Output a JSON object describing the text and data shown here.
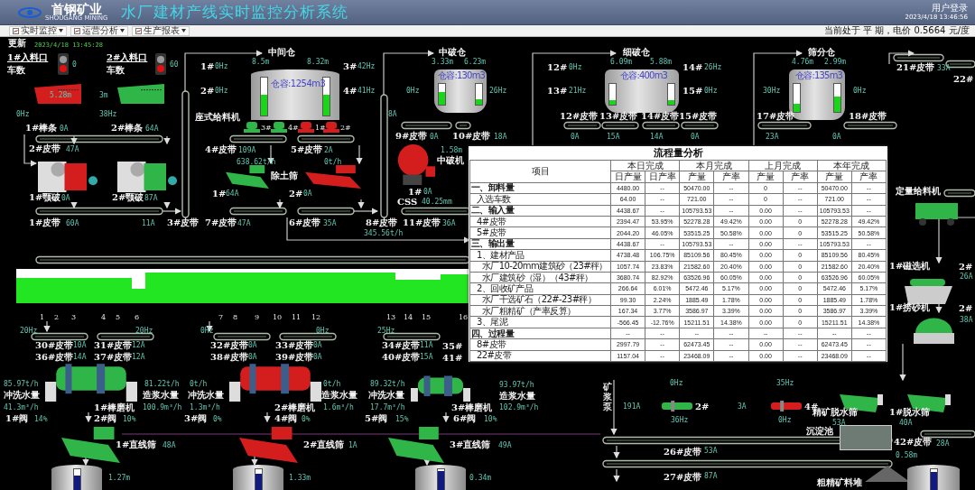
{
  "header": {
    "logo_text": "首钢矿业",
    "logo_subtext": "SHOUGANG MINING",
    "title": "水厂建材产线实时监控分析系统",
    "user_link": "用户登录",
    "time": "2023/4/18 13:46:56"
  },
  "toolbar": {
    "menus": [
      "实时监控",
      "运营分析",
      "生产报表"
    ],
    "price_info": "当前处于 平 期，电价 0.5664 元/度"
  },
  "labels": [
    {
      "text": "更新",
      "kind": "name"
    },
    {
      "text": "2023/4/18 13:45:28",
      "kind": "small"
    },
    {
      "text": "1#入料口",
      "kind": "link"
    },
    {
      "text": "0",
      "kind": "value"
    },
    {
      "text": "车数",
      "kind": "name"
    },
    {
      "text": "2#入料口",
      "kind": "link"
    },
    {
      "text": "车数",
      "kind": "name"
    },
    {
      "text": "60",
      "kind": "value"
    },
    {
      "text": "5.28m",
      "kind": "value"
    },
    {
      "text": "3m",
      "kind": "value"
    },
    {
      "text": "0Hz",
      "kind": "value"
    },
    {
      "text": "38Hz",
      "kind": "value"
    },
    {
      "text": "1#棒条",
      "kind": "name"
    },
    {
      "text": "0A",
      "kind": "value"
    },
    {
      "text": "2#棒条",
      "kind": "name"
    },
    {
      "text": "64A",
      "kind": "value"
    },
    {
      "text": "2#皮带",
      "kind": "name"
    },
    {
      "text": "47A",
      "kind": "value"
    },
    {
      "text": "1#颚破",
      "kind": "name"
    },
    {
      "text": "0A",
      "kind": "value"
    },
    {
      "text": "2#颚破",
      "kind": "name"
    },
    {
      "text": "87A",
      "kind": "value"
    },
    {
      "text": "1#皮带",
      "kind": "name"
    },
    {
      "text": "60A",
      "kind": "value"
    },
    {
      "text": "11A",
      "kind": "value"
    },
    {
      "text": "3#皮带",
      "kind": "name"
    },
    {
      "text": "中间仓",
      "kind": "name"
    },
    {
      "text": "1#",
      "kind": "name"
    },
    {
      "text": "0Hz",
      "kind": "value"
    },
    {
      "text": "8.5m",
      "kind": "value"
    },
    {
      "text": "8.32m",
      "kind": "value"
    },
    {
      "text": "3#",
      "kind": "name"
    },
    {
      "text": "42Hz",
      "kind": "value"
    },
    {
      "text": "2#",
      "kind": "name"
    },
    {
      "text": "0Hz",
      "kind": "value"
    },
    {
      "text": "4#",
      "kind": "name"
    },
    {
      "text": "41Hz",
      "kind": "value"
    },
    {
      "text": "仓容:1254m3",
      "kind": "bin-wide"
    },
    {
      "text": "座式给料机",
      "kind": "name"
    },
    {
      "text": "3#",
      "kind": "tiny"
    },
    {
      "text": "4#",
      "kind": "tiny"
    },
    {
      "text": "1#",
      "kind": "tiny"
    },
    {
      "text": "2#",
      "kind": "tiny"
    },
    {
      "text": "4#皮带",
      "kind": "name"
    },
    {
      "text": "109A",
      "kind": "value"
    },
    {
      "text": "638.62t/h",
      "kind": "value"
    },
    {
      "text": "5#皮带",
      "kind": "name"
    },
    {
      "text": "2A",
      "kind": "value"
    },
    {
      "text": "0t/h",
      "kind": "value"
    },
    {
      "text": "除土筛",
      "kind": "name"
    },
    {
      "text": "1#",
      "kind": "name"
    },
    {
      "text": "64A",
      "kind": "value"
    },
    {
      "text": "2#",
      "kind": "name"
    },
    {
      "text": "0A",
      "kind": "value"
    },
    {
      "text": "7#皮带",
      "kind": "name"
    },
    {
      "text": "47A",
      "kind": "value"
    },
    {
      "text": "6#皮带",
      "kind": "name"
    },
    {
      "text": "35A",
      "kind": "value"
    },
    {
      "text": "8#皮带",
      "kind": "name"
    },
    {
      "text": "345.56t/h",
      "kind": "value"
    },
    {
      "text": "中破仓",
      "kind": "name"
    },
    {
      "text": "3.33m",
      "kind": "value"
    },
    {
      "text": "6.23m",
      "kind": "value"
    },
    {
      "text": "0Hz",
      "kind": "value"
    },
    {
      "text": "仓容:130m3",
      "kind": "bin"
    },
    {
      "text": "8A",
      "kind": "value"
    },
    {
      "text": "9#皮带",
      "kind": "name"
    },
    {
      "text": "0A",
      "kind": "value"
    },
    {
      "text": "10#皮带",
      "kind": "name"
    },
    {
      "text": "1.58m",
      "kind": "value"
    },
    {
      "text": "中破机",
      "kind": "name"
    },
    {
      "text": "1#",
      "kind": "name"
    },
    {
      "text": "0A",
      "kind": "value"
    },
    {
      "text": "CSS",
      "kind": "name"
    },
    {
      "text": "40.25mm",
      "kind": "value"
    },
    {
      "text": "11#皮带",
      "kind": "name"
    },
    {
      "text": "36A",
      "kind": "value"
    },
    {
      "text": "26Hz",
      "kind": "value"
    },
    {
      "text": "18A",
      "kind": "value"
    },
    {
      "text": "细破仓",
      "kind": "name"
    },
    {
      "text": "12#",
      "kind": "name"
    },
    {
      "text": "0Hz",
      "kind": "value"
    },
    {
      "text": "6.09m",
      "kind": "value"
    },
    {
      "text": "5.88m",
      "kind": "value"
    },
    {
      "text": "14#",
      "kind": "name"
    },
    {
      "text": "26Hz",
      "kind": "value"
    },
    {
      "text": "13#",
      "kind": "name"
    },
    {
      "text": "21Hz",
      "kind": "value"
    },
    {
      "text": "仓容:400m3",
      "kind": "bin"
    },
    {
      "text": "15#",
      "kind": "name"
    },
    {
      "text": "0Hz",
      "kind": "value"
    },
    {
      "text": "12#皮带",
      "kind": "name"
    },
    {
      "text": "13#皮带",
      "kind": "name"
    },
    {
      "text": "14#皮带",
      "kind": "name"
    },
    {
      "text": "15#皮带",
      "kind": "name"
    },
    {
      "text": "0A",
      "kind": "value"
    },
    {
      "text": "15A",
      "kind": "value"
    },
    {
      "text": "14A",
      "kind": "value"
    },
    {
      "text": "0A",
      "kind": "value"
    },
    {
      "text": "筛分仓",
      "kind": "name"
    },
    {
      "text": "4.76m",
      "kind": "value"
    },
    {
      "text": "2.99m",
      "kind": "value"
    },
    {
      "text": "30Hz",
      "kind": "value"
    },
    {
      "text": "仓容:135m3",
      "kind": "bin"
    },
    {
      "text": "0Hz",
      "kind": "value"
    },
    {
      "text": "17#皮带",
      "kind": "name"
    },
    {
      "text": "18#皮带",
      "kind": "name"
    },
    {
      "text": "23A",
      "kind": "value"
    },
    {
      "text": "0A",
      "kind": "value"
    },
    {
      "text": "21#皮带",
      "kind": "name"
    },
    {
      "text": "33A",
      "kind": "value"
    },
    {
      "text": "22#",
      "kind": "name"
    },
    {
      "text": "定量给料机",
      "kind": "name"
    },
    {
      "text": "1#磁选机",
      "kind": "name"
    },
    {
      "text": "2#",
      "kind": "name"
    },
    {
      "text": "26A",
      "kind": "value"
    },
    {
      "text": "1#捞砂机",
      "kind": "name"
    },
    {
      "text": "2#",
      "kind": "name"
    },
    {
      "text": "38A",
      "kind": "value"
    },
    {
      "text": "93.97t/h",
      "kind": "value"
    },
    {
      "text": "造浆水量",
      "kind": "name"
    },
    {
      "text": "102.9m³/h",
      "kind": "value"
    },
    {
      "text": "矿浆泵",
      "kind": "vertical"
    },
    {
      "text": "0Hz",
      "kind": "value"
    },
    {
      "text": "35Hz",
      "kind": "value"
    },
    {
      "text": "191A",
      "kind": "value"
    },
    {
      "text": "2#",
      "kind": "name"
    },
    {
      "text": "3A",
      "kind": "value"
    },
    {
      "text": "4#",
      "kind": "name"
    },
    {
      "text": "36Hz",
      "kind": "value"
    },
    {
      "text": "0Hz",
      "kind": "value"
    },
    {
      "text": "精矿脱水筛",
      "kind": "name"
    },
    {
      "text": "53A",
      "kind": "value"
    },
    {
      "text": "沉淀池",
      "kind": "name"
    },
    {
      "text": "1#脱水筛",
      "kind": "name"
    },
    {
      "text": "40A",
      "kind": "value"
    },
    {
      "text": "42#皮带",
      "kind": "name"
    },
    {
      "text": "28A",
      "kind": "value"
    },
    {
      "text": "0.58m",
      "kind": "value"
    },
    {
      "text": "粗精矿料堆",
      "kind": "name"
    },
    {
      "text": "26#皮带",
      "kind": "name"
    },
    {
      "text": "53A",
      "kind": "value"
    },
    {
      "text": "27#皮带",
      "kind": "name"
    },
    {
      "text": "87A",
      "kind": "value"
    },
    {
      "text": "3#直线筛",
      "kind": "name"
    },
    {
      "text": "49A",
      "kind": "value"
    },
    {
      "text": "1",
      "kind": "tiny"
    },
    {
      "text": "2",
      "kind": "tiny"
    },
    {
      "text": "3",
      "kind": "tiny"
    },
    {
      "text": "4",
      "kind": "tiny"
    },
    {
      "text": "5",
      "kind": "tiny"
    },
    {
      "text": "6",
      "kind": "tiny"
    },
    {
      "text": "7",
      "kind": "tiny"
    },
    {
      "text": "8",
      "kind": "tiny"
    },
    {
      "text": "9",
      "kind": "tiny"
    },
    {
      "text": "10",
      "kind": "tiny"
    },
    {
      "text": "11",
      "kind": "tiny"
    },
    {
      "text": "12",
      "kind": "tiny"
    },
    {
      "text": "13",
      "kind": "tiny"
    },
    {
      "text": "14",
      "kind": "tiny"
    },
    {
      "text": "15",
      "kind": "tiny"
    },
    {
      "text": "16",
      "kind": "tiny"
    },
    {
      "text": "20Hz",
      "kind": "value"
    },
    {
      "text": "20Hz",
      "kind": "value"
    },
    {
      "text": "0Hz",
      "kind": "value"
    },
    {
      "text": "0Hz",
      "kind": "value"
    },
    {
      "text": "25Hz",
      "kind": "value"
    },
    {
      "text": "30#皮带",
      "kind": "name"
    },
    {
      "text": "10A",
      "kind": "value"
    },
    {
      "text": "31#皮带",
      "kind": "name"
    },
    {
      "text": "12A",
      "kind": "value"
    },
    {
      "text": "32#皮带",
      "kind": "name"
    },
    {
      "text": "0A",
      "kind": "value"
    },
    {
      "text": "33#皮带",
      "kind": "name"
    },
    {
      "text": "0A",
      "kind": "value"
    },
    {
      "text": "34#皮带",
      "kind": "name"
    },
    {
      "text": "11A",
      "kind": "value"
    },
    {
      "text": "35#",
      "kind": "name"
    },
    {
      "text": "36#皮带",
      "kind": "name"
    },
    {
      "text": "14A",
      "kind": "value"
    },
    {
      "text": "37#皮带",
      "kind": "name"
    },
    {
      "text": "12A",
      "kind": "value"
    },
    {
      "text": "38#皮带",
      "kind": "name"
    },
    {
      "text": "0A",
      "kind": "value"
    },
    {
      "text": "39#皮带",
      "kind": "name"
    },
    {
      "text": "0A",
      "kind": "value"
    },
    {
      "text": "40#皮带",
      "kind": "name"
    },
    {
      "text": "15A",
      "kind": "value"
    },
    {
      "text": "41#",
      "kind": "name"
    },
    {
      "text": "85.97t/h",
      "kind": "value"
    },
    {
      "text": "81.22t/h",
      "kind": "value"
    },
    {
      "text": "0t/h",
      "kind": "value"
    },
    {
      "text": "0t/h",
      "kind": "value"
    },
    {
      "text": "89.32t/h",
      "kind": "value"
    },
    {
      "text": "冲洗水量",
      "kind": "name"
    },
    {
      "text": "造浆水量",
      "kind": "name"
    },
    {
      "text": "冲洗水量",
      "kind": "name"
    },
    {
      "text": "造浆水量",
      "kind": "name"
    },
    {
      "text": "冲洗水量",
      "kind": "name"
    },
    {
      "text": "41.3m³/h",
      "kind": "value"
    },
    {
      "text": "1#棒磨机",
      "kind": "name"
    },
    {
      "text": "100.9m³/h",
      "kind": "value"
    },
    {
      "text": "1.3m³/h",
      "kind": "value"
    },
    {
      "text": "2#棒磨机",
      "kind": "name"
    },
    {
      "text": "1.6m³/h",
      "kind": "value"
    },
    {
      "text": "17.7m³/h",
      "kind": "value"
    },
    {
      "text": "3#棒磨机",
      "kind": "name"
    },
    {
      "text": "1#阀",
      "kind": "name"
    },
    {
      "text": "14%",
      "kind": "value"
    },
    {
      "text": "2#阀",
      "kind": "name"
    },
    {
      "text": "10%",
      "kind": "value"
    },
    {
      "text": "3#阀",
      "kind": "name"
    },
    {
      "text": "0%",
      "kind": "value"
    },
    {
      "text": "4#阀",
      "kind": "name"
    },
    {
      "text": "0%",
      "kind": "value"
    },
    {
      "text": "5#阀",
      "kind": "name"
    },
    {
      "text": "15%",
      "kind": "value"
    },
    {
      "text": "6#阀",
      "kind": "name"
    },
    {
      "text": "10%",
      "kind": "value"
    },
    {
      "text": "1#直线筛",
      "kind": "name"
    },
    {
      "text": "48A",
      "kind": "value"
    },
    {
      "text": "2#直线筛",
      "kind": "name"
    },
    {
      "text": "1A",
      "kind": "value"
    },
    {
      "text": "1.27m",
      "kind": "value"
    },
    {
      "text": "1.33m",
      "kind": "value"
    },
    {
      "text": "0.34m",
      "kind": "value"
    }
  ],
  "machines": [
    {
      "kind": "grizzly",
      "running": false
    },
    {
      "kind": "grizzly",
      "running": true
    },
    {
      "kind": "jaw",
      "running": false
    },
    {
      "kind": "jaw",
      "running": true
    },
    {
      "kind": "apron",
      "running": true
    },
    {
      "kind": "apron",
      "running": true
    },
    {
      "kind": "apron",
      "running": false
    },
    {
      "kind": "apron",
      "running": false
    },
    {
      "kind": "screen",
      "running": true
    },
    {
      "kind": "screen",
      "running": false
    },
    {
      "kind": "cone",
      "running": false
    },
    {
      "kind": "mill",
      "running": true
    },
    {
      "kind": "mill",
      "running": false
    },
    {
      "kind": "mill",
      "running": true
    },
    {
      "kind": "screen",
      "running": true
    },
    {
      "kind": "screen",
      "running": false
    },
    {
      "kind": "screen",
      "running": true
    },
    {
      "kind": "pump",
      "running": true
    },
    {
      "kind": "pump",
      "running": false
    },
    {
      "kind": "truck",
      "running": true
    },
    {
      "kind": "separator",
      "running": true
    },
    {
      "kind": "washer",
      "running": true
    },
    {
      "kind": "dewater",
      "running": true
    },
    {
      "kind": "dewater",
      "running": true
    }
  ],
  "bins": [
    {
      "gauges": [
        {
          "level": 0.55
        },
        {
          "level": 0.55
        }
      ]
    },
    {
      "gauges": [
        {
          "level": 0.6
        },
        {
          "level": 0.25
        }
      ]
    },
    {
      "gauges": [
        {
          "level": 0.2
        },
        {
          "level": 0.22
        }
      ]
    },
    {
      "gauges": [
        {
          "level": 0.3
        },
        {
          "level": 0.55
        }
      ]
    }
  ],
  "tanks": [
    {
      "level": 0.7
    },
    {
      "level": 0.8
    },
    {
      "level": 0.9
    },
    {
      "level": 0.85
    }
  ],
  "flow_table": {
    "title": "流程量分析",
    "corner": "项目",
    "groups": [
      "本日完成",
      "本月完成",
      "上月完成",
      "本年完成"
    ],
    "subheaders": [
      "日产量",
      "日产率",
      "产量",
      "产率",
      "产量",
      "产率",
      "产量",
      "产率"
    ],
    "rows": [
      {
        "item": "一、卸料量",
        "kind": "section",
        "cells": [
          "4480.00",
          "--",
          "50470.00",
          "--",
          "0",
          "--",
          "50470.00",
          "--"
        ]
      },
      {
        "item": "入选车数",
        "kind": "sub",
        "cells": [
          "64.00",
          "--",
          "721.00",
          "--",
          "0",
          "--",
          "721.00",
          "--"
        ]
      },
      {
        "item": "二、输入量",
        "kind": "section",
        "cells": [
          "4438.67",
          "--",
          "105793.53",
          "--",
          "0.00",
          "--",
          "105793.53",
          "--"
        ]
      },
      {
        "item": "4#皮带",
        "kind": "sub",
        "cells": [
          "2394.47",
          "53.95%",
          "52278.28",
          "49.42%",
          "0.00",
          "0",
          "52278.28",
          "49.42%"
        ]
      },
      {
        "item": "5#皮带",
        "kind": "sub",
        "cells": [
          "2044.20",
          "46.05%",
          "53515.25",
          "50.58%",
          "0.00",
          "0",
          "53515.25",
          "50.58%"
        ]
      },
      {
        "item": "三、输出量",
        "kind": "section",
        "cells": [
          "4438.67",
          "--",
          "105793.53",
          "--",
          "0.00",
          "--",
          "105793.53",
          "--"
        ]
      },
      {
        "item": "1、建材产品",
        "kind": "sub",
        "cells": [
          "4738.48",
          "106.75%",
          "85109.56",
          "80.45%",
          "0.00",
          "0",
          "85109.56",
          "80.45%"
        ]
      },
      {
        "item": "水厂10-20mm建筑砂（23#秤）",
        "kind": "subsub",
        "cells": [
          "1057.74",
          "23.83%",
          "21582.60",
          "20.40%",
          "0.00",
          "0",
          "21582.60",
          "20.40%"
        ]
      },
      {
        "item": "水厂建筑砂（湿）（43#秤）",
        "kind": "subsub",
        "cells": [
          "3680.74",
          "82.92%",
          "63526.96",
          "60.05%",
          "0.00",
          "0",
          "63526.96",
          "60.05%"
        ]
      },
      {
        "item": "2、回收矿产品",
        "kind": "sub",
        "cells": [
          "266.64",
          "6.01%",
          "5472.46",
          "5.17%",
          "0.00",
          "0",
          "5472.46",
          "5.17%"
        ]
      },
      {
        "item": "水厂干选矿石（22#-23#秤）",
        "kind": "subsub",
        "cells": [
          "99.30",
          "2.24%",
          "1885.49",
          "1.78%",
          "0.00",
          "0",
          "1885.49",
          "1.78%"
        ]
      },
      {
        "item": "水厂粗精矿（产率反算）",
        "kind": "subsub",
        "cells": [
          "167.34",
          "3.77%",
          "3586.97",
          "3.39%",
          "0.00",
          "0",
          "3586.97",
          "3.39%"
        ]
      },
      {
        "item": "3、尾泥",
        "kind": "sub",
        "cells": [
          "-566.45",
          "-12.76%",
          "15211.51",
          "14.38%",
          "0.00",
          "0",
          "15211.51",
          "14.38%"
        ]
      },
      {
        "item": "四、过程量",
        "kind": "section",
        "cells": [
          "--",
          "--",
          "--",
          "--",
          "--",
          "--",
          "--",
          "--"
        ]
      },
      {
        "item": "8#皮带",
        "kind": "sub",
        "cells": [
          "2997.79",
          "--",
          "62473.45",
          "--",
          "0.00",
          "--",
          "62473.45",
          "--"
        ]
      },
      {
        "item": "22#皮带",
        "kind": "sub",
        "cells": [
          "1157.04",
          "--",
          "23468.09",
          "--",
          "0.00",
          "--",
          "23468.09",
          "--"
        ]
      }
    ]
  }
}
